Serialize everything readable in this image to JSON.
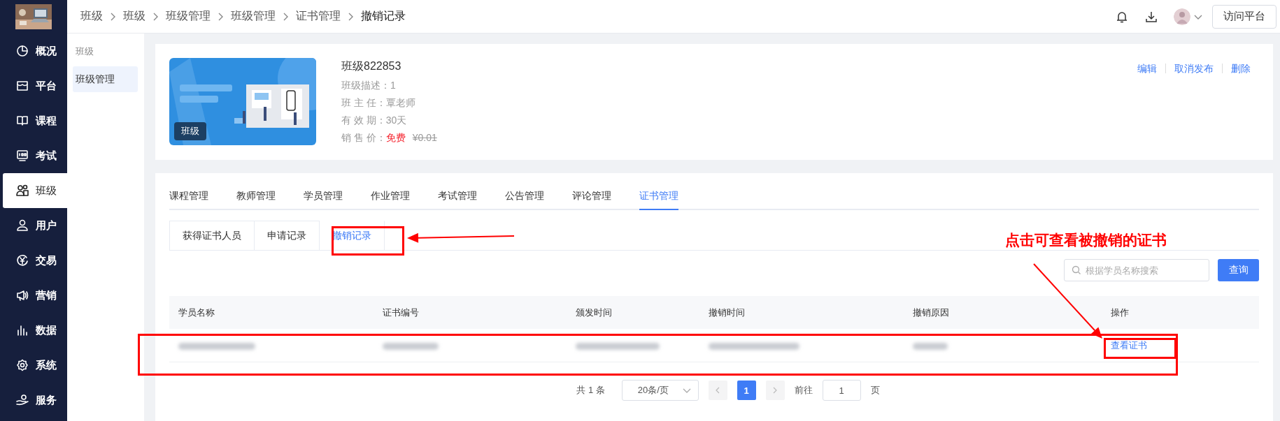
{
  "sidebar": {
    "items": [
      {
        "label": "概况",
        "selected": false
      },
      {
        "label": "平台",
        "selected": false
      },
      {
        "label": "课程",
        "selected": false
      },
      {
        "label": "考试",
        "selected": false
      },
      {
        "label": "班级",
        "selected": true
      },
      {
        "label": "用户",
        "selected": false
      },
      {
        "label": "交易",
        "selected": false
      },
      {
        "label": "营销",
        "selected": false
      },
      {
        "label": "数据",
        "selected": false
      },
      {
        "label": "系统",
        "selected": false
      },
      {
        "label": "服务",
        "selected": false
      }
    ]
  },
  "breadcrumb": [
    "班级",
    "班级",
    "班级管理",
    "班级管理",
    "证书管理",
    "撤销记录"
  ],
  "header": {
    "button": "访问平台"
  },
  "subnav": {
    "heading": "班级",
    "items": [
      {
        "label": "班级管理",
        "selected": true
      }
    ]
  },
  "class_card": {
    "badge": "班级",
    "title": "班级822853",
    "fields": [
      {
        "label": "班级描述：",
        "value": "1"
      },
      {
        "label": "班 主 任：",
        "value": "覃老师"
      },
      {
        "label": "有 效 期：",
        "value": "30天"
      }
    ],
    "price": {
      "label": "销 售 价：",
      "value": "免费",
      "original": "¥0.01"
    },
    "actions": [
      "编辑",
      "取消发布",
      "删除"
    ]
  },
  "tabs": [
    {
      "label": "课程管理",
      "selected": false
    },
    {
      "label": "教师管理",
      "selected": false
    },
    {
      "label": "学员管理",
      "selected": false
    },
    {
      "label": "作业管理",
      "selected": false
    },
    {
      "label": "考试管理",
      "selected": false
    },
    {
      "label": "公告管理",
      "selected": false
    },
    {
      "label": "评论管理",
      "selected": false
    },
    {
      "label": "证书管理",
      "selected": true
    }
  ],
  "subtabs": [
    {
      "label": "获得证书人员",
      "selected": false
    },
    {
      "label": "申请记录",
      "selected": false
    },
    {
      "label": "撤销记录",
      "selected": true
    }
  ],
  "search": {
    "placeholder": "根据学员名称搜索",
    "button": "查询"
  },
  "table": {
    "columns": [
      "学员名称",
      "证书编号",
      "颁发时间",
      "撤销时间",
      "撤销原因",
      "操作"
    ],
    "rows": [
      {
        "cells": [
          {
            "kind": "blurred"
          },
          {
            "kind": "blurred"
          },
          {
            "kind": "blurred"
          },
          {
            "kind": "blurred"
          },
          {
            "kind": "blurred"
          },
          {
            "kind": "link",
            "text": "查看证书"
          }
        ]
      }
    ]
  },
  "pagination": {
    "total": "共 1 条",
    "page_size": "20条/页",
    "pages": [
      {
        "label": "1",
        "selected": true
      }
    ],
    "goto_label": "前往",
    "goto_value": "1",
    "goto_suffix": "页"
  },
  "annotations": [
    {
      "kind": "box"
    },
    {
      "kind": "arrow"
    },
    {
      "kind": "text",
      "text": "点击可查看被撤销的证书"
    },
    {
      "kind": "box"
    },
    {
      "kind": "box"
    },
    {
      "kind": "arrow"
    }
  ]
}
